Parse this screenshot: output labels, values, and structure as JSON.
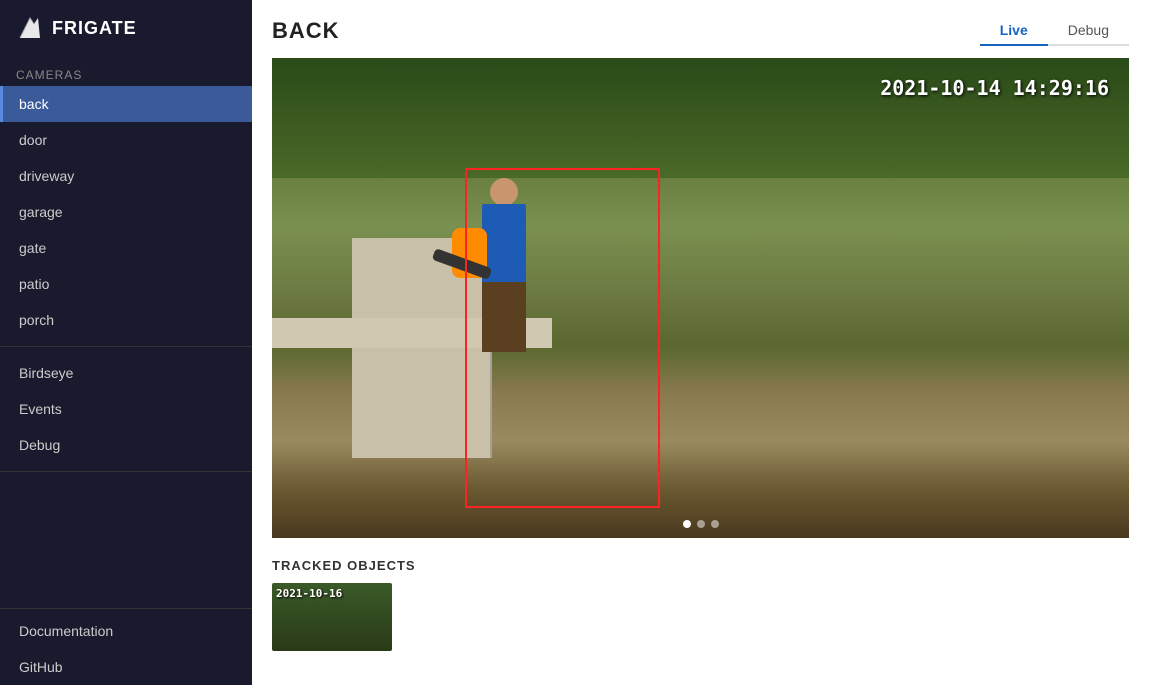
{
  "app": {
    "name": "FRIGATE"
  },
  "sidebar": {
    "cameras_label": "Cameras",
    "cameras": [
      {
        "id": "back",
        "label": "back",
        "active": true
      },
      {
        "id": "door",
        "label": "door",
        "active": false
      },
      {
        "id": "driveway",
        "label": "driveway",
        "active": false
      },
      {
        "id": "garage",
        "label": "garage",
        "active": false
      },
      {
        "id": "gate",
        "label": "gate",
        "active": false
      },
      {
        "id": "patio",
        "label": "patio",
        "active": false
      },
      {
        "id": "porch",
        "label": "porch",
        "active": false
      }
    ],
    "birdseye_label": "Birdseye",
    "events_label": "Events",
    "debug_label": "Debug",
    "documentation_label": "Documentation",
    "github_label": "GitHub"
  },
  "page": {
    "title": "BACK",
    "tabs": [
      {
        "id": "live",
        "label": "Live",
        "active": true
      },
      {
        "id": "debug",
        "label": "Debug",
        "active": false
      }
    ]
  },
  "camera": {
    "timestamp": "2021-10-14 14:29:16"
  },
  "tracked_objects": {
    "title": "TRACKED OBJECTS",
    "thumbnail_date": "2021-10-16"
  }
}
